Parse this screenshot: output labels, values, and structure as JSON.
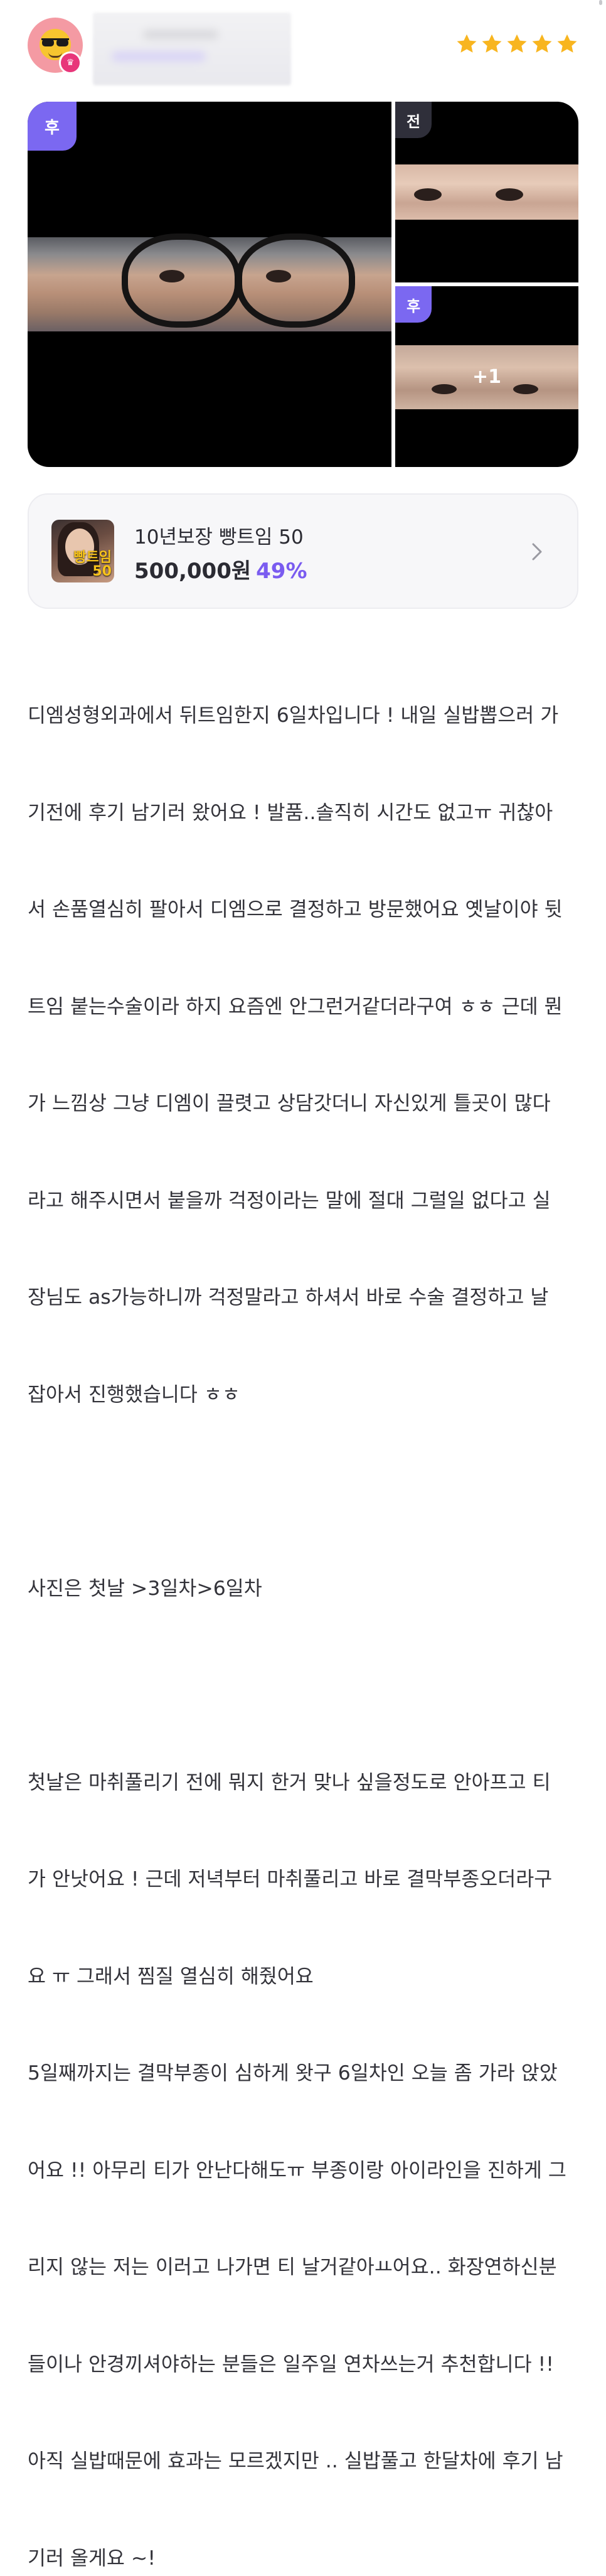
{
  "rating": {
    "stars": 5,
    "star_color": "#f8b51f"
  },
  "gallery": {
    "main_tag": "후",
    "top_right_tag": "전",
    "bottom_right_tag": "후",
    "more_count": "+1",
    "accent": "#7b68f1"
  },
  "product": {
    "thumbnail_text": "빵트임 50",
    "name": "10년보장 빵트임 50",
    "price": "500,000원",
    "discount": "49%"
  },
  "review_lines": [
    "디엠성형외과에서 뒤트임한지 6일차입니다 ! 내일 실밥뽑으러 가",
    "기전에 후기 남기러 왔어요 ! 발품..솔직히 시간도 없고ㅠ 귀찮아",
    "서 손품열심히 팔아서 디엠으로 결정하고 방문했어요 옛날이야 뒷",
    "트임 붙는수술이라 하지 요즘엔 안그런거같더라구여 ㅎㅎ 근데 뭔",
    "가 느낌상 그냥 디엠이 끌렷고 상담갓더니 자신있게 틀곳이 많다",
    "라고 해주시면서 붙을까 걱정이라는 말에 절대 그럴일 없다고 실",
    "장님도 as가능하니까 걱정말라고 하셔서 바로 수술 결정하고 날",
    "잡아서 진행했습니다 ㅎㅎ",
    "",
    "사진은 첫날 >3일차>6일차",
    "",
    "첫날은 마취풀리기 전에 뭐지 한거 맞나 싶을정도로 안아프고 티",
    "가 안낫어요 ! 근데 저녁부터 마취풀리고 바로 결막부종오더라구",
    "요 ㅠ 그래서 찜질 열심히 해줬어요",
    "5일째까지는 결막부종이 심하게 왓구 6일차인 오늘 좀 가라 앉았",
    "어요 !! 아무리 티가 안난다해도ㅠ 부종이랑 아이라인을 진하게 그",
    "리지 않는 저는 이러고 나가면 티 날거같아ㅛ어요.. 화장연하신분",
    "들이나 안경끼셔야하는 분들은 일주일 연차쓰는거 추천합니다 !!",
    "아직 실밥때문에 효과는 모르겠지만 .. 실밥풀고 한달차에 후기 남",
    "기러 올게요 ~!"
  ]
}
